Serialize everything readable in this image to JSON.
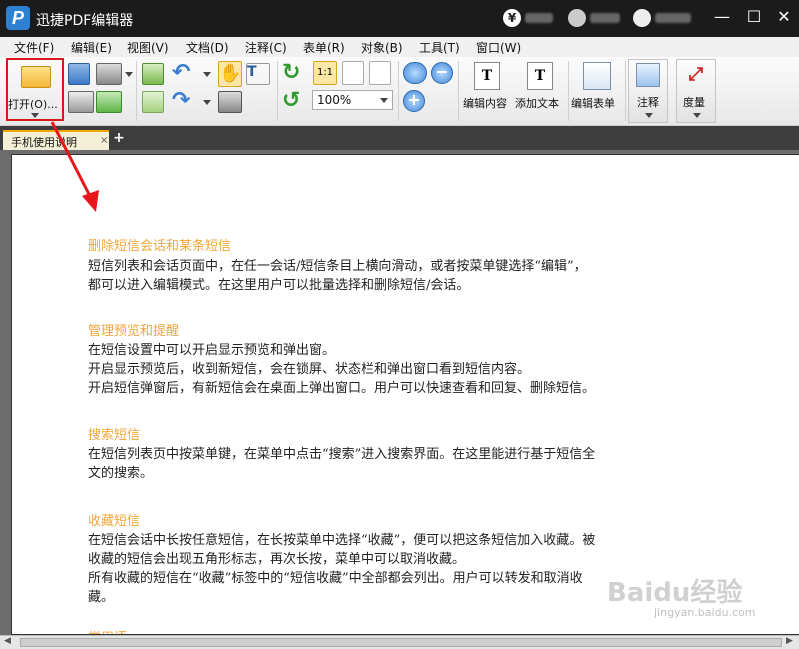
{
  "app": {
    "title": "迅捷PDF编辑器",
    "logo_letter": "P"
  },
  "titlebar": {
    "currency_symbol": "¥",
    "minimize": "—",
    "maximize": "☐",
    "close": "✕"
  },
  "menu": [
    "文件(F)",
    "编辑(E)",
    "视图(V)",
    "文档(D)",
    "注释(C)",
    "表单(R)",
    "对象(B)",
    "工具(T)",
    "窗口(W)"
  ],
  "toolbar": {
    "open_label": "打开(O)...",
    "zoom_value": "100%",
    "edit_content_label": "编辑内容",
    "add_text_label": "添加文本",
    "edit_form_label": "编辑表单",
    "annotate_label": "注释",
    "measure_label": "度量",
    "zoom_ratio_label": "1:1"
  },
  "tabs": [
    {
      "label": "手机使用说明",
      "close": "×"
    }
  ],
  "tab_add": "+",
  "document": {
    "sections": [
      {
        "title": "删除短信会话和某条短信",
        "lines": [
          "短信列表和会话页面中，在任一会话/短信条目上横向滑动，或者按菜单键选择“编辑”，",
          "都可以进入编辑模式。在这里用户可以批量选择和删除短信/会话。"
        ]
      },
      {
        "title": "管理预览和提醒",
        "lines": [
          "在短信设置中可以开启显示预览和弹出窗。",
          "开启显示预览后，收到新短信，会在锁屏、状态栏和弹出窗口看到短信内容。",
          "开启短信弹窗后，有新短信会在桌面上弹出窗口。用户可以快速查看和回复、删除短信。"
        ]
      },
      {
        "title": "搜索短信",
        "lines": [
          "在短信列表页中按菜单键，在菜单中点击“搜索”进入搜索界面。在这里能进行基于短信全",
          "文的搜索。"
        ]
      },
      {
        "title": "收藏短信",
        "lines": [
          "在短信会话中长按任意短信，在长按菜单中选择“收藏”，便可以把这条短信加入收藏。被",
          "收藏的短信会出现五角形标志，再次长按，菜单中可以取消收藏。",
          "所有收藏的短信在“收藏”标签中的“短信收藏”中全部都会列出。用户可以转发和取消收",
          "藏。"
        ]
      },
      {
        "title": "常用语",
        "lines": []
      }
    ]
  },
  "watermark": {
    "main": "Baidu经验",
    "sub": "jingyan.baidu.com"
  },
  "colors": {
    "accent_title": "#f0a63a",
    "highlight_border": "#d6181e",
    "arrow": "#e8151b"
  }
}
